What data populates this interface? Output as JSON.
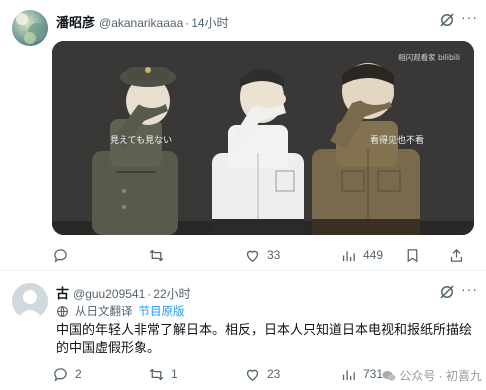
{
  "tweet1": {
    "name": "潘昭彦",
    "handle": "@akanarikaaaa",
    "separator": "·",
    "time": "14小时",
    "media": {
      "caption_left": "見えても見ない",
      "caption_right": "看得见也不看",
      "watermark": "相闪观看家 bilibili"
    },
    "actions": {
      "reply": "",
      "retweet": "",
      "likes": "33",
      "views": "449"
    }
  },
  "tweet2": {
    "name": "古",
    "handle": "@guu209541",
    "separator": "·",
    "time": "22小时",
    "translated_from": "从日文翻译",
    "show_original": "节目原版",
    "body": "中国的年轻人非常了解日本。相反，日本人只知道日本电视和报纸所描绘的中国虚假形象。",
    "actions": {
      "reply": "2",
      "retweet": "1",
      "likes": "23",
      "views": "731"
    }
  },
  "footer_watermark": "公众号 · 初喜九",
  "colors": {
    "text": "#0f1419",
    "muted": "#536471",
    "link": "#1d9bf0",
    "divider": "#eff3f4"
  },
  "icons": [
    "grok-icon",
    "more-icon",
    "reply-icon",
    "retweet-icon",
    "like-icon",
    "views-icon",
    "bookmark-icon",
    "share-icon"
  ]
}
